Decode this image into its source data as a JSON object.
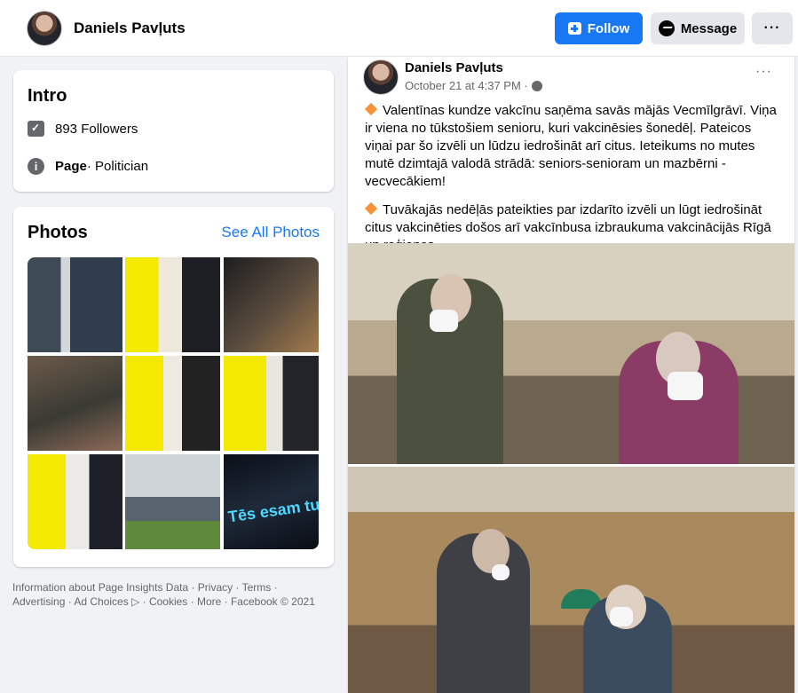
{
  "header": {
    "page_name": "Daniels Pavļuts",
    "follow_label": "Follow",
    "message_label": "Message",
    "more_label": "···"
  },
  "intro": {
    "title": "Intro",
    "followers": "893 Followers",
    "page_label": "Page",
    "page_category": " · Politician"
  },
  "photos": {
    "title": "Photos",
    "see_all": "See All Photos",
    "p9_text": "Tēs esam tuvāk! Nāc vakcin"
  },
  "footer": {
    "text": "Information about Page Insights Data · Privacy · Terms · Advertising · Ad Choices ▷ · Cookies · More · Facebook © 2021"
  },
  "post": {
    "author": "Daniels Pavļuts",
    "date": "October 21 at 4:37 PM ·",
    "more": "···",
    "paragraph1": "Valentīnas kundze vakcīnu saņēma savās mājās Vecmīlgrāvī. Viņa ir viena no tūkstošiem senioru, kuri vakcinēsies šonedēļ. Pateicos viņai par šo izvēli un lūdzu iedrošināt arī citus. Ieteikums no mutes mutē dzimtajā valodā strādā: seniors-senioram un mazbērni - vecvecākiem!",
    "paragraph2": "Tuvākajās nedēļās pateikties par izdarīto izvēli un lūgt iedrošināt citus vakcinēties došos arī vakcīnbusa izbraukuma vakcinācijās Rīgā un reģionos."
  }
}
